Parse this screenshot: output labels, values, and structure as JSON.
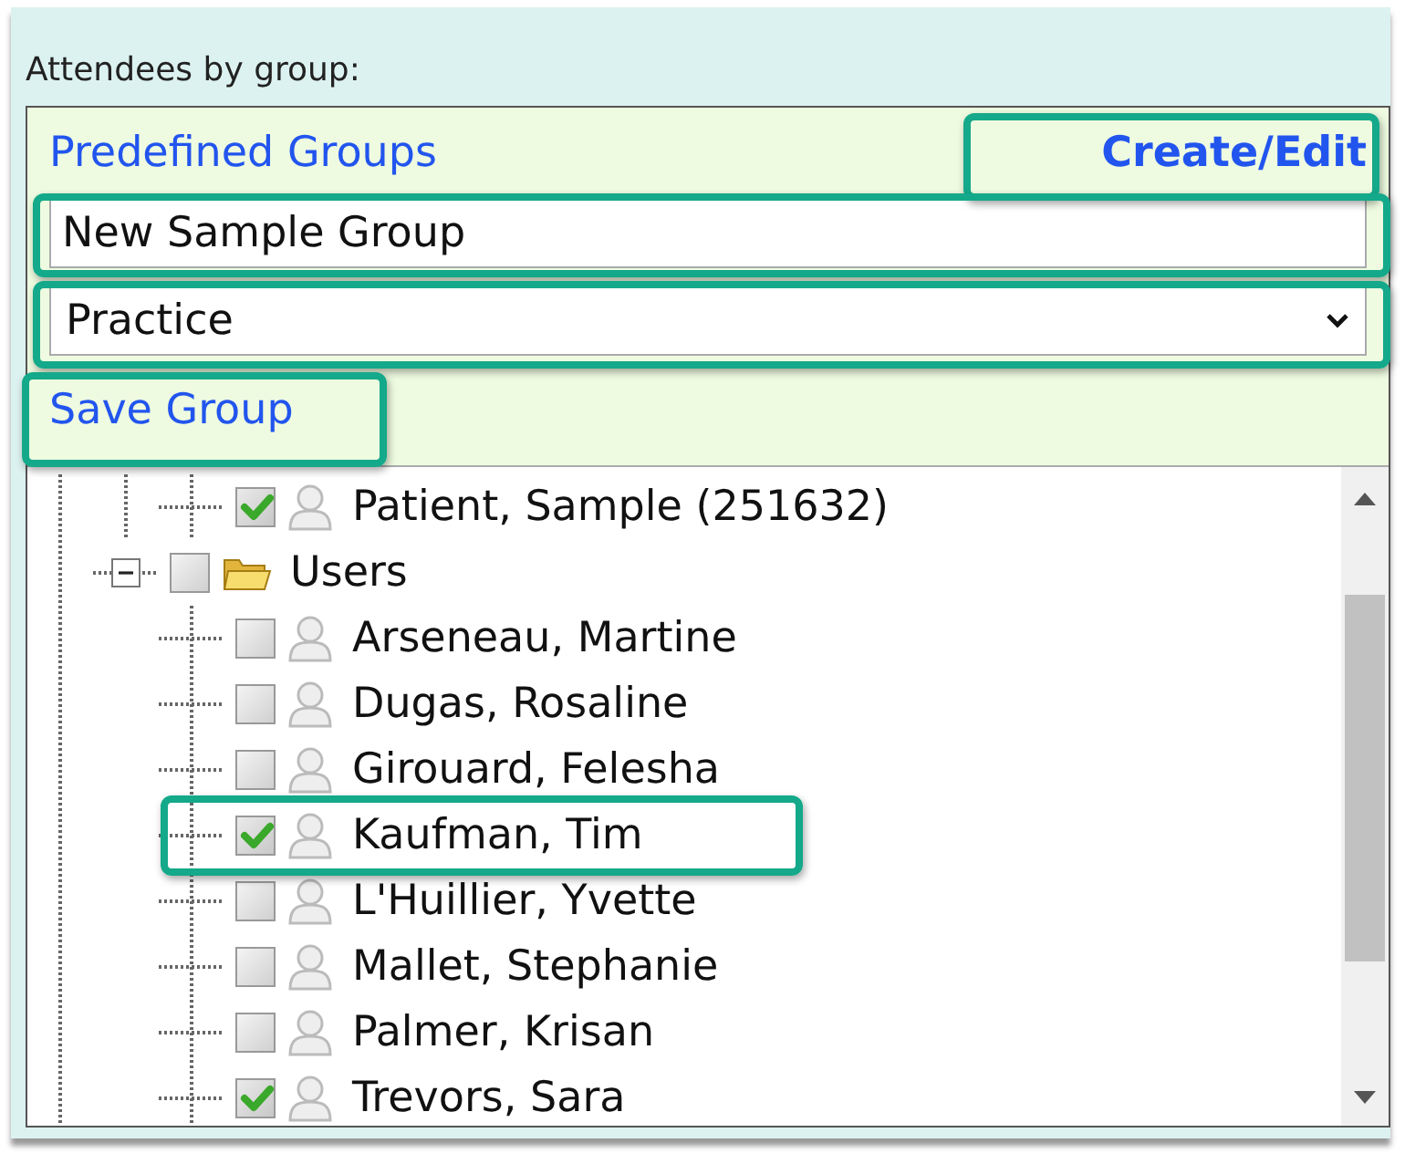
{
  "section_label": "Attendees by group:",
  "groups_header": {
    "title": "Predefined Groups",
    "action": "Create/Edit"
  },
  "group_name": {
    "value": "New Sample Group"
  },
  "group_type": {
    "value": "Practice"
  },
  "save_link": "Save Group",
  "tree": [
    {
      "kind": "person",
      "label": "Patient, Sample (251632)",
      "checked": true
    },
    {
      "kind": "folder",
      "label": "Users",
      "checked": false,
      "expanded": true,
      "children": [
        {
          "kind": "person",
          "label": "Arseneau, Martine",
          "checked": false
        },
        {
          "kind": "person",
          "label": "Dugas, Rosaline",
          "checked": false
        },
        {
          "kind": "person",
          "label": "Girouard, Felesha",
          "checked": false
        },
        {
          "kind": "person",
          "label": "Kaufman, Tim",
          "checked": true
        },
        {
          "kind": "person",
          "label": "L'Huillier, Yvette",
          "checked": false
        },
        {
          "kind": "person",
          "label": "Mallet, Stephanie",
          "checked": false
        },
        {
          "kind": "person",
          "label": "Palmer, Krisan",
          "checked": false
        },
        {
          "kind": "person",
          "label": "Trevors, Sara",
          "checked": true
        }
      ]
    }
  ]
}
